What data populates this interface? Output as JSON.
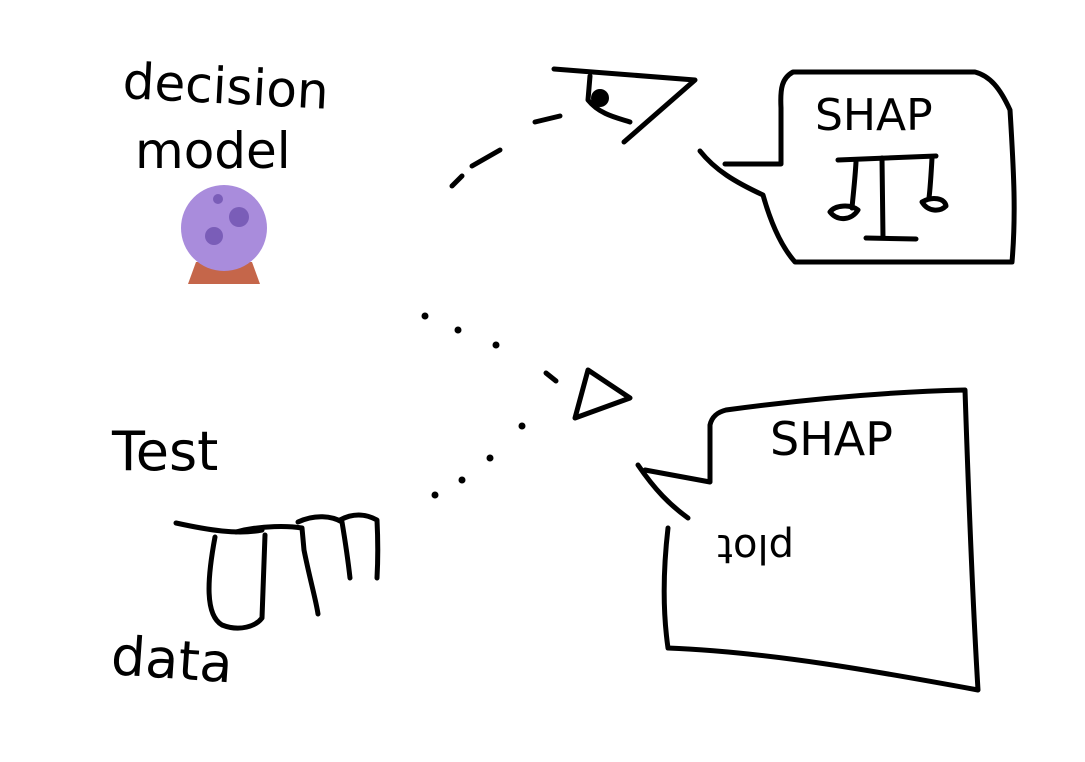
{
  "labels": {
    "model_line1": "decision",
    "model_line2": "model",
    "test_line1": "Test",
    "test_line2": "data"
  },
  "bubbles": {
    "top": {
      "title": "SHAP",
      "icon": "balance-scale-icon"
    },
    "bottom": {
      "title": "SHAP",
      "subtitle": "plot"
    }
  },
  "icons": {
    "model": "crystal-ball-icon",
    "data": "database-stack-icon",
    "observer_top": "eye-icon",
    "observer_bottom": "eye-icon"
  },
  "colors": {
    "ink": "#000000",
    "ball": "#A98CDC",
    "ball_spots": "#7A5DB8",
    "ball_base": "#C5664A"
  }
}
